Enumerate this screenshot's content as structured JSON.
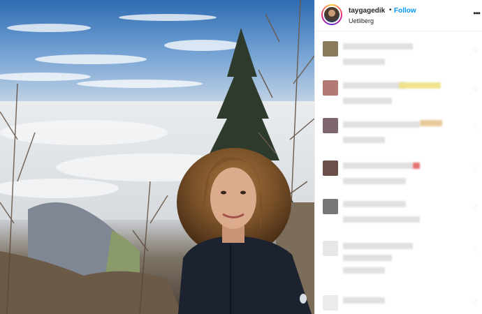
{
  "post": {
    "username": "taygagedik",
    "separator": "•",
    "follow_label": "Follow",
    "location": "Uetliberg",
    "more_icon": "more-options-icon"
  },
  "comments_area": {
    "state": "blurred",
    "heart_icon": "heart-outline-icon"
  },
  "colors": {
    "follow_blue": "#0095f6",
    "text_dark": "#262626",
    "divider": "#efefef"
  }
}
